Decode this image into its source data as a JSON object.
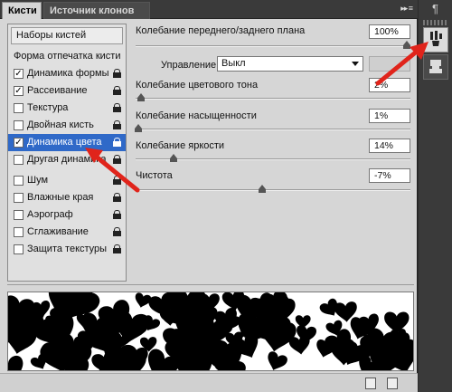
{
  "tabs": [
    {
      "label": "Кисти"
    },
    {
      "label": "Источник клонов"
    }
  ],
  "tab_menu": "▸▸ ≡",
  "left_panel": {
    "presets_button": "Наборы кистей",
    "items": [
      {
        "label": "Форма отпечатка кисти",
        "checkbox": false,
        "checked": false,
        "lock": false
      },
      {
        "label": "Динамика формы",
        "checkbox": true,
        "checked": true,
        "lock": true
      },
      {
        "label": "Рассеивание",
        "checkbox": true,
        "checked": true,
        "lock": true
      },
      {
        "label": "Текстура",
        "checkbox": true,
        "checked": false,
        "lock": true
      },
      {
        "label": "Двойная кисть",
        "checkbox": true,
        "checked": false,
        "lock": true
      },
      {
        "label": "Динамика цвета",
        "checkbox": true,
        "checked": true,
        "lock": true,
        "selected": true
      },
      {
        "label": "Другая динамика",
        "checkbox": true,
        "checked": false,
        "lock": true
      },
      {
        "label": "Шум",
        "checkbox": true,
        "checked": false,
        "lock": true
      },
      {
        "label": "Влажные края",
        "checkbox": true,
        "checked": false,
        "lock": true
      },
      {
        "label": "Аэрограф",
        "checkbox": true,
        "checked": false,
        "lock": true
      },
      {
        "label": "Сглаживание",
        "checkbox": true,
        "checked": false,
        "lock": true
      },
      {
        "label": "Защита текстуры",
        "checkbox": true,
        "checked": false,
        "lock": true
      }
    ]
  },
  "controls": {
    "fg_bg_jitter": {
      "label": "Колебание переднего/заднего плана",
      "value": "100%",
      "level": 100
    },
    "control": {
      "label": "Управление:",
      "value": "Выкл"
    },
    "hue_jitter": {
      "label": "Колебание цветового тона",
      "value": "2%",
      "level": 2
    },
    "saturation_jitter": {
      "label": "Колебание насыщенности",
      "value": "1%",
      "level": 1
    },
    "brightness_jitter": {
      "label": "Колебание яркости",
      "value": "14%",
      "level": 14
    },
    "purity": {
      "label": "Чистота",
      "value": "-7%",
      "level": -7
    }
  },
  "side_panel": {
    "top_icon": "¶",
    "buttons": [
      "brush-panel-icon",
      "clone-source-icon"
    ]
  },
  "colors": {
    "selection": "#2f69c8",
    "panel_bg": "#d6d6d6",
    "annotation_arrow": "#e0241b"
  }
}
